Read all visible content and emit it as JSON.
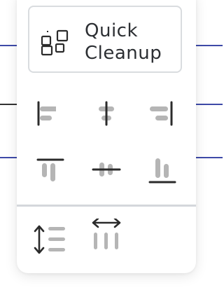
{
  "colors": {
    "accent_line": "#3e4aa8",
    "dark_line": "#333333",
    "icon_dark": "#2b2b2b",
    "icon_light": "#b5b5b5",
    "panel_border": "#d9dcdf",
    "divider": "#d4d7db",
    "text": "#2c2f33"
  },
  "quick_cleanup": {
    "label_line1": "Quick",
    "label_line2": "Cleanup",
    "icon": "cleanup-grid-icon"
  },
  "align_tools": [
    {
      "name": "align-left",
      "icon": "align-left-icon"
    },
    {
      "name": "align-center-horizontal",
      "icon": "align-center-horizontal-icon"
    },
    {
      "name": "align-right",
      "icon": "align-right-icon"
    },
    {
      "name": "align-top",
      "icon": "align-top-icon"
    },
    {
      "name": "align-center-vertical",
      "icon": "align-center-vertical-icon"
    },
    {
      "name": "align-bottom",
      "icon": "align-bottom-icon"
    }
  ],
  "distribute_tools": [
    {
      "name": "distribute-vertical",
      "icon": "distribute-vertical-icon"
    },
    {
      "name": "distribute-horizontal",
      "icon": "distribute-horizontal-icon"
    }
  ]
}
